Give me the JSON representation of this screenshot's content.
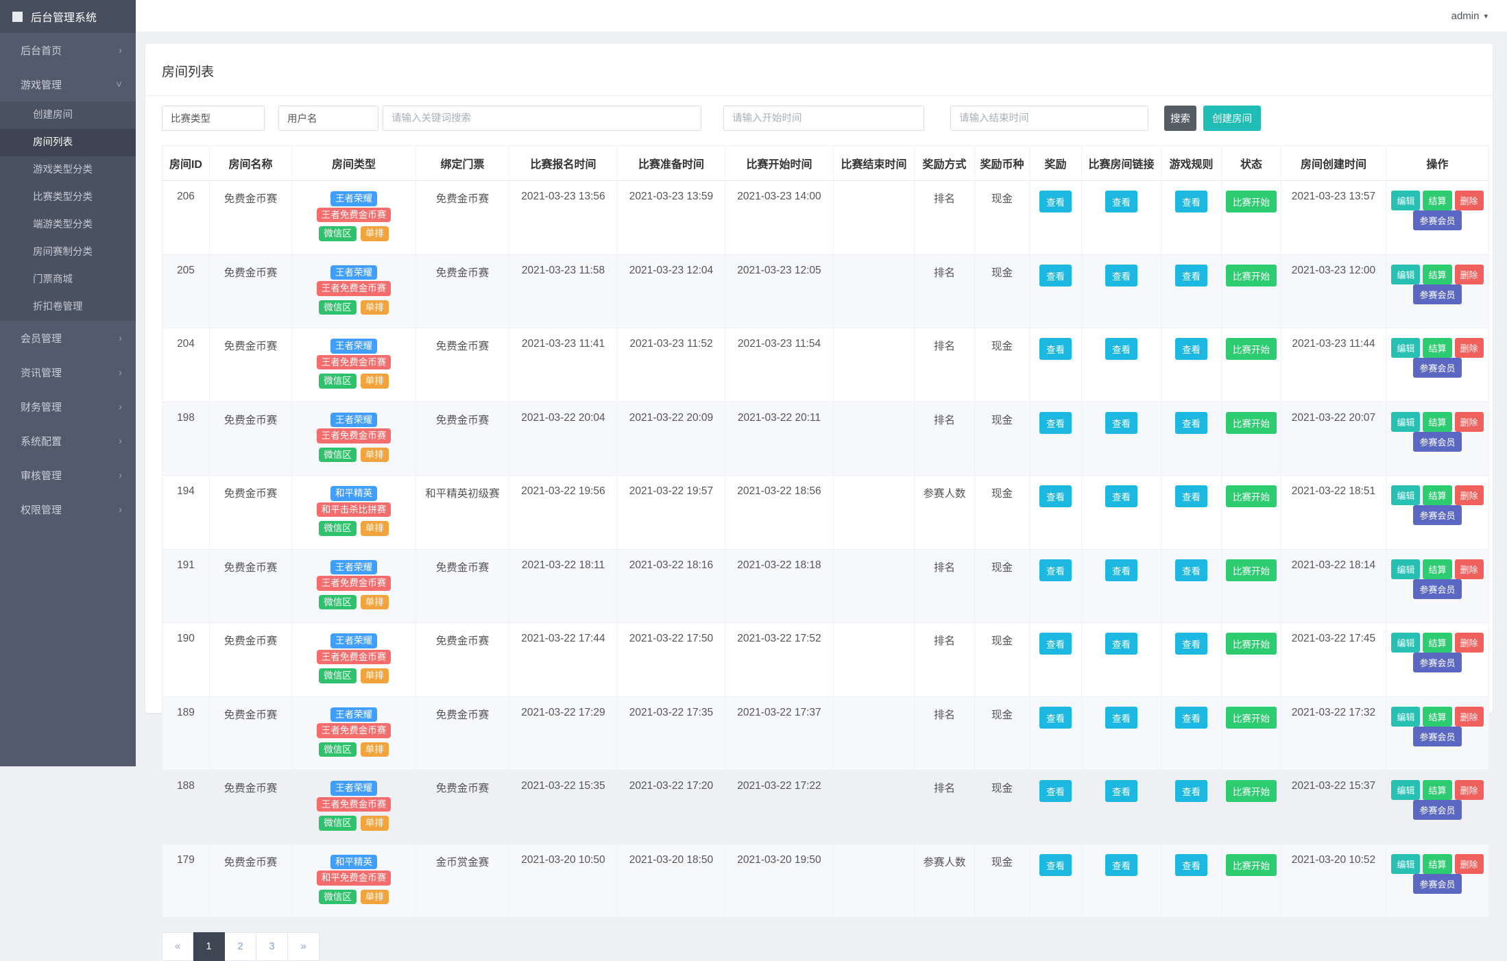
{
  "brand": {
    "title": "后台管理系统"
  },
  "topbar": {
    "user": "admin"
  },
  "sidebar": {
    "items": [
      {
        "label": "后台首页",
        "expanded": false
      },
      {
        "label": "游戏管理",
        "expanded": true,
        "children": [
          "创建房间",
          "房间列表",
          "游戏类型分类",
          "比赛类型分类",
          "端游类型分类",
          "房间赛制分类",
          "门票商城",
          "折扣卷管理"
        ],
        "active_child": "房间列表"
      },
      {
        "label": "会员管理",
        "expanded": false
      },
      {
        "label": "资讯管理",
        "expanded": false
      },
      {
        "label": "财务管理",
        "expanded": false
      },
      {
        "label": "系统配置",
        "expanded": false
      },
      {
        "label": "审核管理",
        "expanded": false
      },
      {
        "label": "权限管理",
        "expanded": false
      }
    ]
  },
  "page": {
    "title": "房间列表"
  },
  "filters": {
    "match_type_value": "比赛类型",
    "username_value": "用户名",
    "keyword_placeholder": "请输入关键词搜索",
    "start_placeholder": "请输入开始时间",
    "end_placeholder": "请输入结束时间",
    "search_label": "搜索",
    "create_label": "创建房间"
  },
  "table": {
    "columns": [
      "房间ID",
      "房间名称",
      "房间类型",
      "绑定门票",
      "比赛报名时间",
      "比赛准备时间",
      "比赛开始时间",
      "比赛结束时间",
      "奖励方式",
      "奖励币种",
      "奖励",
      "比赛房间链接",
      "游戏规则",
      "状态",
      "房间创建时间",
      "操作"
    ],
    "view_label": "查看",
    "status_label": "比赛开始",
    "actions": [
      "编辑",
      "结算",
      "删除",
      "参赛会员"
    ],
    "rows": [
      {
        "id": "206",
        "name": "免费金币赛",
        "tags": [
          {
            "text": "王者荣耀",
            "color": "blue"
          },
          {
            "text": "王者免费金币赛",
            "color": "red"
          },
          {
            "text": "微信区",
            "color": "green"
          },
          {
            "text": "单排",
            "color": "orange"
          }
        ],
        "ticket": "免费金币赛",
        "signup": "2021-03-23 13:56",
        "ready": "2021-03-23 13:59",
        "start": "2021-03-23 14:00",
        "end": "",
        "reward_mode": "排名",
        "currency": "现金",
        "created": "2021-03-23 13:57"
      },
      {
        "id": "205",
        "name": "免费金币赛",
        "tags": [
          {
            "text": "王者荣耀",
            "color": "blue"
          },
          {
            "text": "王者免费金币赛",
            "color": "red"
          },
          {
            "text": "微信区",
            "color": "green"
          },
          {
            "text": "单排",
            "color": "orange"
          }
        ],
        "ticket": "免费金币赛",
        "signup": "2021-03-23 11:58",
        "ready": "2021-03-23 12:04",
        "start": "2021-03-23 12:05",
        "end": "",
        "reward_mode": "排名",
        "currency": "现金",
        "created": "2021-03-23 12:00"
      },
      {
        "id": "204",
        "name": "免费金币赛",
        "tags": [
          {
            "text": "王者荣耀",
            "color": "blue"
          },
          {
            "text": "王者免费金币赛",
            "color": "red"
          },
          {
            "text": "微信区",
            "color": "green"
          },
          {
            "text": "单排",
            "color": "orange"
          }
        ],
        "ticket": "免费金币赛",
        "signup": "2021-03-23 11:41",
        "ready": "2021-03-23 11:52",
        "start": "2021-03-23 11:54",
        "end": "",
        "reward_mode": "排名",
        "currency": "现金",
        "created": "2021-03-23 11:44"
      },
      {
        "id": "198",
        "name": "免费金币赛",
        "tags": [
          {
            "text": "王者荣耀",
            "color": "blue"
          },
          {
            "text": "王者免费金币赛",
            "color": "red"
          },
          {
            "text": "微信区",
            "color": "green"
          },
          {
            "text": "单排",
            "color": "orange"
          }
        ],
        "ticket": "免费金币赛",
        "signup": "2021-03-22 20:04",
        "ready": "2021-03-22 20:09",
        "start": "2021-03-22 20:11",
        "end": "",
        "reward_mode": "排名",
        "currency": "现金",
        "created": "2021-03-22 20:07"
      },
      {
        "id": "194",
        "name": "免费金币赛",
        "tags": [
          {
            "text": "和平精英",
            "color": "blue"
          },
          {
            "text": "和平击杀比拼赛",
            "color": "red"
          },
          {
            "text": "微信区",
            "color": "green"
          },
          {
            "text": "单排",
            "color": "orange"
          }
        ],
        "ticket": "和平精英初级赛",
        "signup": "2021-03-22 19:56",
        "ready": "2021-03-22 19:57",
        "start": "2021-03-22 18:56",
        "end": "",
        "reward_mode": "参赛人数",
        "currency": "现金",
        "created": "2021-03-22 18:51"
      },
      {
        "id": "191",
        "name": "免费金币赛",
        "tags": [
          {
            "text": "王者荣耀",
            "color": "blue"
          },
          {
            "text": "王者免费金币赛",
            "color": "red"
          },
          {
            "text": "微信区",
            "color": "green"
          },
          {
            "text": "单排",
            "color": "orange"
          }
        ],
        "ticket": "免费金币赛",
        "signup": "2021-03-22 18:11",
        "ready": "2021-03-22 18:16",
        "start": "2021-03-22 18:18",
        "end": "",
        "reward_mode": "排名",
        "currency": "现金",
        "created": "2021-03-22 18:14"
      },
      {
        "id": "190",
        "name": "免费金币赛",
        "tags": [
          {
            "text": "王者荣耀",
            "color": "blue"
          },
          {
            "text": "王者免费金币赛",
            "color": "red"
          },
          {
            "text": "微信区",
            "color": "green"
          },
          {
            "text": "单排",
            "color": "orange"
          }
        ],
        "ticket": "免费金币赛",
        "signup": "2021-03-22 17:44",
        "ready": "2021-03-22 17:50",
        "start": "2021-03-22 17:52",
        "end": "",
        "reward_mode": "排名",
        "currency": "现金",
        "created": "2021-03-22 17:45"
      },
      {
        "id": "189",
        "name": "免费金币赛",
        "tags": [
          {
            "text": "王者荣耀",
            "color": "blue"
          },
          {
            "text": "王者免费金币赛",
            "color": "red"
          },
          {
            "text": "微信区",
            "color": "green"
          },
          {
            "text": "单排",
            "color": "orange"
          }
        ],
        "ticket": "免费金币赛",
        "signup": "2021-03-22 17:29",
        "ready": "2021-03-22 17:35",
        "start": "2021-03-22 17:37",
        "end": "",
        "reward_mode": "排名",
        "currency": "现金",
        "created": "2021-03-22 17:32"
      },
      {
        "id": "188",
        "name": "免费金币赛",
        "tags": [
          {
            "text": "王者荣耀",
            "color": "blue"
          },
          {
            "text": "王者免费金币赛",
            "color": "red"
          },
          {
            "text": "微信区",
            "color": "green"
          },
          {
            "text": "单排",
            "color": "orange"
          }
        ],
        "ticket": "免费金币赛",
        "signup": "2021-03-22 15:35",
        "ready": "2021-03-22 17:20",
        "start": "2021-03-22 17:22",
        "end": "",
        "reward_mode": "排名",
        "currency": "现金",
        "created": "2021-03-22 15:37"
      },
      {
        "id": "179",
        "name": "免费金币赛",
        "tags": [
          {
            "text": "和平精英",
            "color": "blue"
          },
          {
            "text": "和平免费金币赛",
            "color": "red"
          },
          {
            "text": "微信区",
            "color": "green"
          },
          {
            "text": "单排",
            "color": "orange"
          }
        ],
        "ticket": "金币赏金赛",
        "signup": "2021-03-20 10:50",
        "ready": "2021-03-20 18:50",
        "start": "2021-03-20 19:50",
        "end": "",
        "reward_mode": "参赛人数",
        "currency": "现金",
        "created": "2021-03-20 10:52"
      }
    ]
  },
  "pagination": {
    "items": [
      "«",
      "1",
      "2",
      "3",
      "»"
    ],
    "active": "1"
  },
  "icons": {
    "brand": "square",
    "chevron_right": "›",
    "chevron_down": "˅",
    "caret_down": "▾"
  },
  "colors": {
    "sidebar_bg": "#525A6B",
    "sidebar_brand_bg": "#474E5D",
    "sidebar_submenu_bg": "#4A5161",
    "sidebar_active_bg": "#3E4453",
    "body_bg": "#EEF0F4",
    "card_bg": "#FFFFFF",
    "btn_search": "#545C64",
    "btn_create": "#1FBDB5",
    "tag_blue": "#409EFF",
    "tag_red": "#F56C6C",
    "tag_green": "#2DC26B",
    "tag_orange": "#F2A33C",
    "btn_view": "#1CB8E2",
    "btn_status": "#2ECC71",
    "btn_edit": "#27C0B2",
    "btn_settle": "#2ECC71",
    "btn_delete": "#F0605D",
    "btn_members": "#5A68C4",
    "pagination_active_bg": "#3E4553",
    "pagination_link": "#7DA2E8"
  }
}
